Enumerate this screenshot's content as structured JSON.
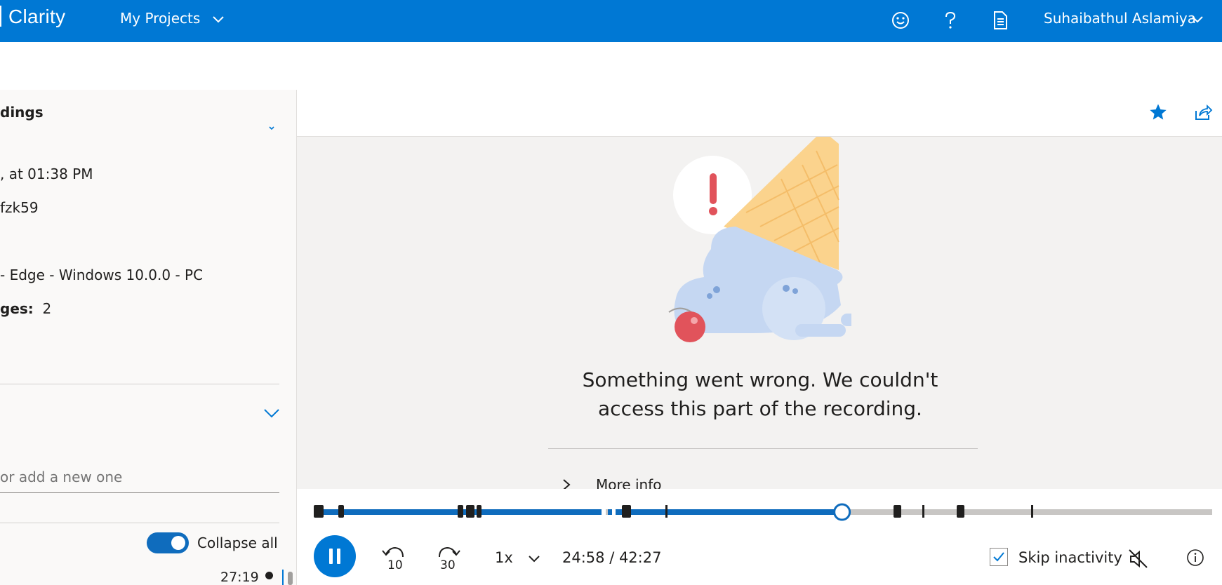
{
  "topbar": {
    "brand": "Clarity",
    "projects_label": "My Projects",
    "user_name": "Suhaibathul Aslamiya",
    "icons": [
      "smiley-icon",
      "help-icon",
      "document-icon"
    ]
  },
  "left_panel": {
    "title": "dings",
    "rows": [
      {
        "text": ", at 01:38 PM"
      },
      {
        "text": "fzk59"
      },
      {
        "text": "- Edge - Windows 10.0.0 - PC"
      },
      {
        "label": "ges:",
        "value": "2"
      }
    ],
    "search_placeholder": "or add a new one",
    "collapse_label": "Collapse all",
    "collapse_enabled": true,
    "bottom_time": "27:19"
  },
  "player": {
    "error_message": "Something went wrong. We couldn't access this part of the recording.",
    "more_info_label": "More info"
  },
  "controls": {
    "speed": "1x",
    "time_display": "24:58 / 42:27",
    "skip_back_label": "10",
    "skip_forward_label": "30",
    "skip_inactivity_label": "Skip inactivity",
    "skip_inactivity_checked": true,
    "progress_fraction": 0.588
  },
  "colors": {
    "brand": "#0078d4",
    "progress": "#0f6cbd",
    "track": "#c8c6c4"
  }
}
